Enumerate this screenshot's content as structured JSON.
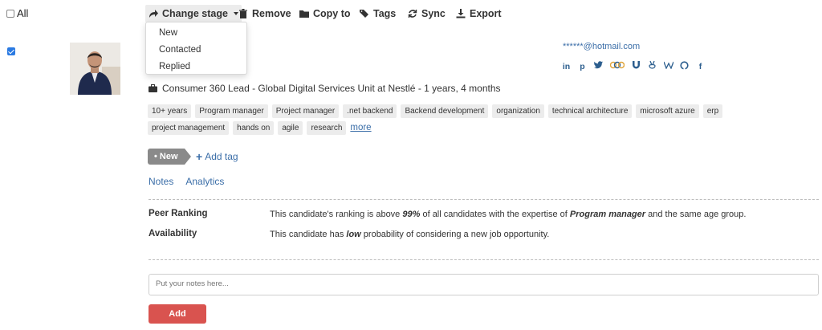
{
  "toolbar": {
    "all_label": "All",
    "change_stage": "Change stage",
    "remove": "Remove",
    "copy_to": "Copy to",
    "tags": "Tags",
    "sync": "Sync",
    "export": "Export"
  },
  "stage_menu": [
    "New",
    "Contacted",
    "Replied"
  ],
  "candidate": {
    "email": "******@hotmail.com",
    "socials": [
      "linkedin-icon",
      "producthunt-icon",
      "twitter-icon",
      "meetup-icon",
      "magnet-icon",
      "angellist-icon",
      "wordpress-icon",
      "github-icon",
      "facebook-icon"
    ],
    "job": "Consumer 360 Lead - Global Digital Services Unit at Nestlé - 1 years, 4 months",
    "tags": [
      "10+ years",
      "Program manager",
      "Project manager",
      ".net backend",
      "Backend development",
      "organization",
      "technical architecture",
      "microsoft azure",
      "erp",
      "project management",
      "hands on",
      "agile",
      "research"
    ],
    "more_label": "more",
    "stage": "New",
    "add_tag_label": "Add tag",
    "notes_link": "Notes",
    "analytics_link": "Analytics"
  },
  "analytics": {
    "peer_ranking_label": "Peer Ranking",
    "peer_pre": "This candidate's ranking is above ",
    "peer_pct": "99%",
    "peer_mid": " of all candidates with the expertise of ",
    "peer_skill": "Program manager",
    "peer_post": " and the same age group.",
    "availability_label": "Availability",
    "avail_pre": "This candidate has ",
    "avail_level": "low",
    "avail_post": " probability of considering a new job opportunity."
  },
  "notes_form": {
    "placeholder": "Put your notes here...",
    "add_button": "Add"
  },
  "colors": {
    "link": "#3b6ea8",
    "add_button": "#d9534f",
    "stage_badge": "#8a8a8a"
  }
}
